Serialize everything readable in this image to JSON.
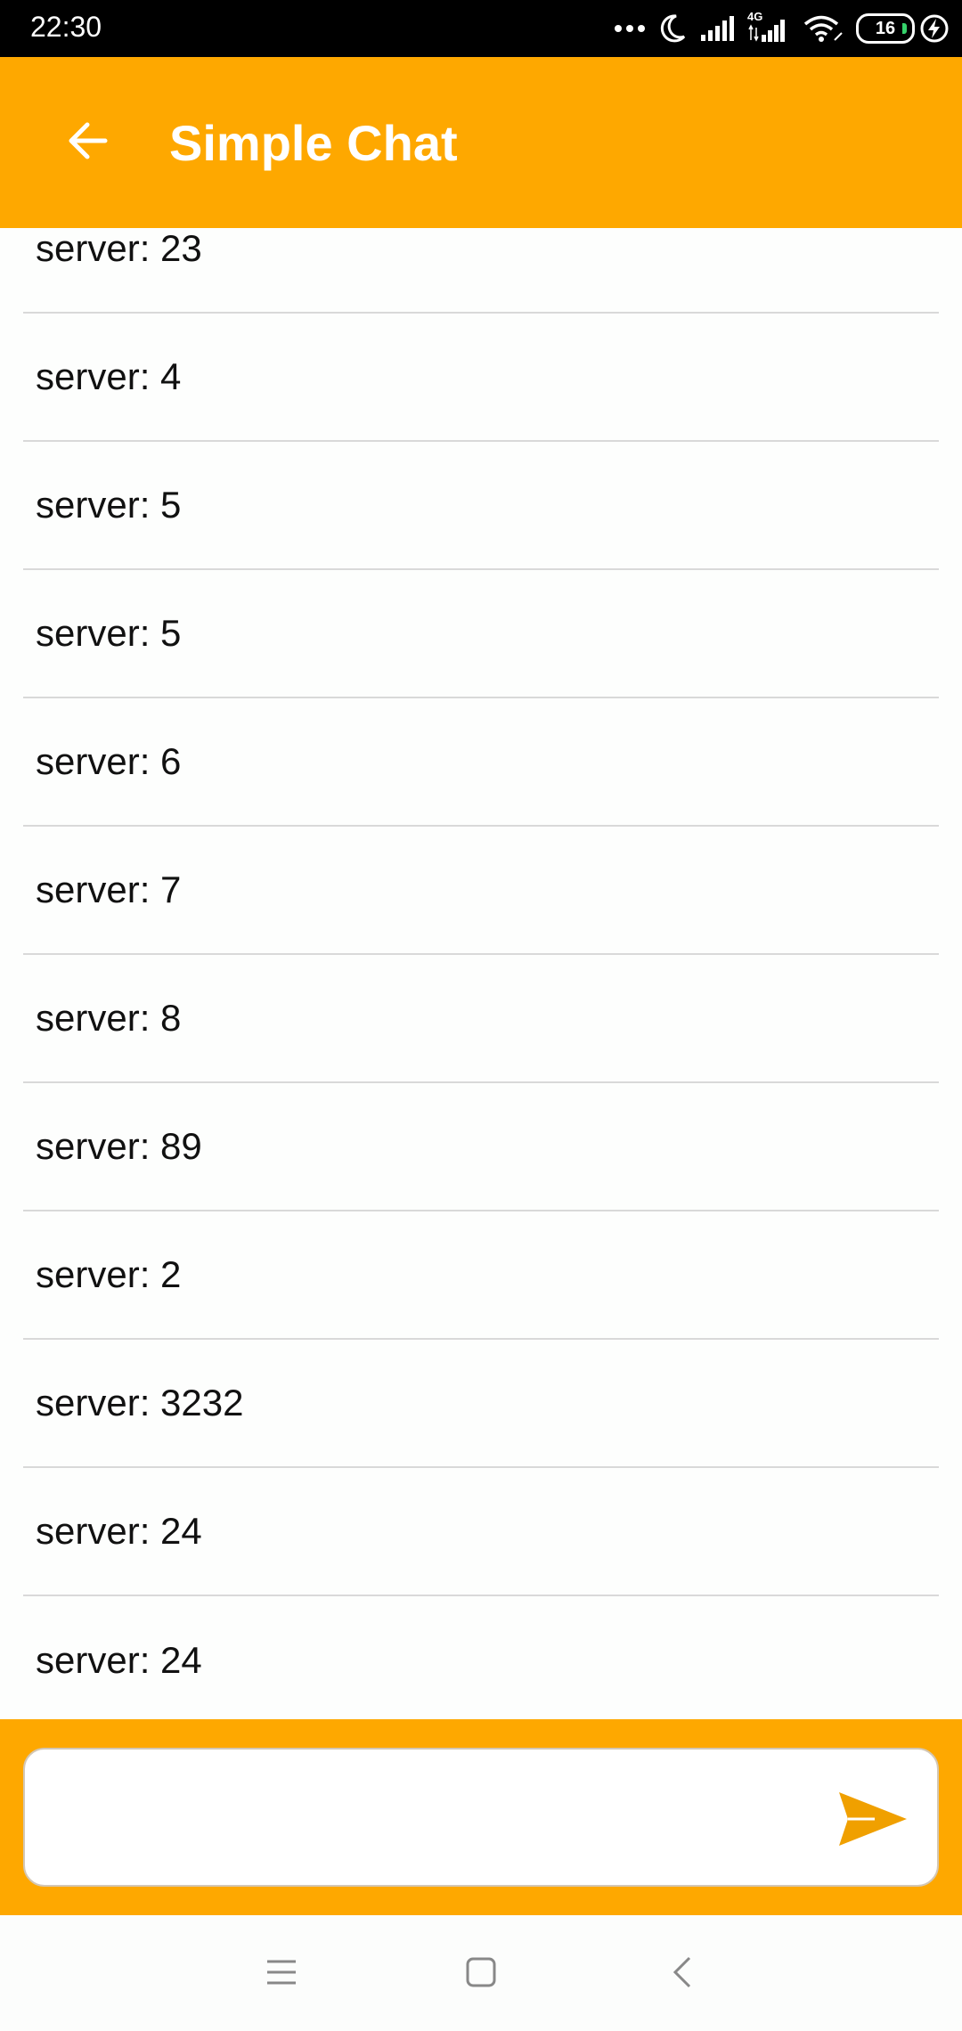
{
  "status_bar": {
    "time": "22:30",
    "network": "4G",
    "battery": "16",
    "icons": [
      "dots-icon",
      "moon-icon",
      "signal-icon",
      "signal-4g-icon",
      "wifi-icon",
      "battery-icon",
      "charging-icon"
    ]
  },
  "app_bar": {
    "title": "Simple Chat",
    "back_icon": "arrow-left-icon",
    "color": "#fea800"
  },
  "messages": [
    {
      "text": "server: 23"
    },
    {
      "text": "server: 4"
    },
    {
      "text": "server: 5"
    },
    {
      "text": "server: 5"
    },
    {
      "text": "server: 6"
    },
    {
      "text": "server: 7"
    },
    {
      "text": "server: 8"
    },
    {
      "text": "server: 89"
    },
    {
      "text": "server: 2"
    },
    {
      "text": "server: 3232"
    },
    {
      "text": "server: 24"
    },
    {
      "text": "server: 24"
    }
  ],
  "composer": {
    "input_value": "",
    "send_icon": "send-icon",
    "send_color": "#f0a000"
  },
  "nav_bar": {
    "icons": [
      "menu-icon",
      "home-icon",
      "back-icon"
    ]
  }
}
